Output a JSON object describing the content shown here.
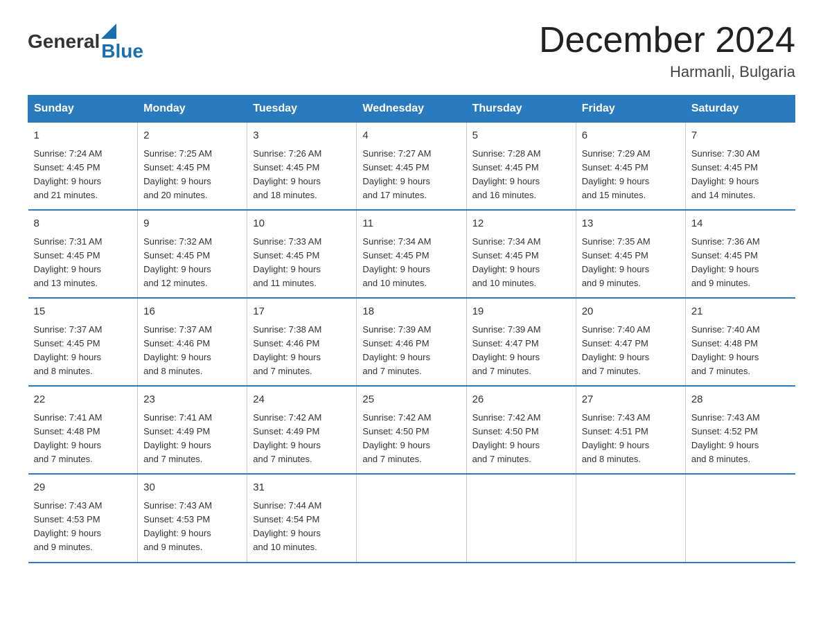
{
  "header": {
    "logo_general": "General",
    "logo_blue": "Blue",
    "title": "December 2024",
    "location": "Harmanli, Bulgaria"
  },
  "days_of_week": [
    "Sunday",
    "Monday",
    "Tuesday",
    "Wednesday",
    "Thursday",
    "Friday",
    "Saturday"
  ],
  "weeks": [
    [
      {
        "day": "1",
        "sunrise": "7:24 AM",
        "sunset": "4:45 PM",
        "daylight": "9 hours and 21 minutes."
      },
      {
        "day": "2",
        "sunrise": "7:25 AM",
        "sunset": "4:45 PM",
        "daylight": "9 hours and 20 minutes."
      },
      {
        "day": "3",
        "sunrise": "7:26 AM",
        "sunset": "4:45 PM",
        "daylight": "9 hours and 18 minutes."
      },
      {
        "day": "4",
        "sunrise": "7:27 AM",
        "sunset": "4:45 PM",
        "daylight": "9 hours and 17 minutes."
      },
      {
        "day": "5",
        "sunrise": "7:28 AM",
        "sunset": "4:45 PM",
        "daylight": "9 hours and 16 minutes."
      },
      {
        "day": "6",
        "sunrise": "7:29 AM",
        "sunset": "4:45 PM",
        "daylight": "9 hours and 15 minutes."
      },
      {
        "day": "7",
        "sunrise": "7:30 AM",
        "sunset": "4:45 PM",
        "daylight": "9 hours and 14 minutes."
      }
    ],
    [
      {
        "day": "8",
        "sunrise": "7:31 AM",
        "sunset": "4:45 PM",
        "daylight": "9 hours and 13 minutes."
      },
      {
        "day": "9",
        "sunrise": "7:32 AM",
        "sunset": "4:45 PM",
        "daylight": "9 hours and 12 minutes."
      },
      {
        "day": "10",
        "sunrise": "7:33 AM",
        "sunset": "4:45 PM",
        "daylight": "9 hours and 11 minutes."
      },
      {
        "day": "11",
        "sunrise": "7:34 AM",
        "sunset": "4:45 PM",
        "daylight": "9 hours and 10 minutes."
      },
      {
        "day": "12",
        "sunrise": "7:34 AM",
        "sunset": "4:45 PM",
        "daylight": "9 hours and 10 minutes."
      },
      {
        "day": "13",
        "sunrise": "7:35 AM",
        "sunset": "4:45 PM",
        "daylight": "9 hours and 9 minutes."
      },
      {
        "day": "14",
        "sunrise": "7:36 AM",
        "sunset": "4:45 PM",
        "daylight": "9 hours and 9 minutes."
      }
    ],
    [
      {
        "day": "15",
        "sunrise": "7:37 AM",
        "sunset": "4:45 PM",
        "daylight": "9 hours and 8 minutes."
      },
      {
        "day": "16",
        "sunrise": "7:37 AM",
        "sunset": "4:46 PM",
        "daylight": "9 hours and 8 minutes."
      },
      {
        "day": "17",
        "sunrise": "7:38 AM",
        "sunset": "4:46 PM",
        "daylight": "9 hours and 7 minutes."
      },
      {
        "day": "18",
        "sunrise": "7:39 AM",
        "sunset": "4:46 PM",
        "daylight": "9 hours and 7 minutes."
      },
      {
        "day": "19",
        "sunrise": "7:39 AM",
        "sunset": "4:47 PM",
        "daylight": "9 hours and 7 minutes."
      },
      {
        "day": "20",
        "sunrise": "7:40 AM",
        "sunset": "4:47 PM",
        "daylight": "9 hours and 7 minutes."
      },
      {
        "day": "21",
        "sunrise": "7:40 AM",
        "sunset": "4:48 PM",
        "daylight": "9 hours and 7 minutes."
      }
    ],
    [
      {
        "day": "22",
        "sunrise": "7:41 AM",
        "sunset": "4:48 PM",
        "daylight": "9 hours and 7 minutes."
      },
      {
        "day": "23",
        "sunrise": "7:41 AM",
        "sunset": "4:49 PM",
        "daylight": "9 hours and 7 minutes."
      },
      {
        "day": "24",
        "sunrise": "7:42 AM",
        "sunset": "4:49 PM",
        "daylight": "9 hours and 7 minutes."
      },
      {
        "day": "25",
        "sunrise": "7:42 AM",
        "sunset": "4:50 PM",
        "daylight": "9 hours and 7 minutes."
      },
      {
        "day": "26",
        "sunrise": "7:42 AM",
        "sunset": "4:50 PM",
        "daylight": "9 hours and 7 minutes."
      },
      {
        "day": "27",
        "sunrise": "7:43 AM",
        "sunset": "4:51 PM",
        "daylight": "9 hours and 8 minutes."
      },
      {
        "day": "28",
        "sunrise": "7:43 AM",
        "sunset": "4:52 PM",
        "daylight": "9 hours and 8 minutes."
      }
    ],
    [
      {
        "day": "29",
        "sunrise": "7:43 AM",
        "sunset": "4:53 PM",
        "daylight": "9 hours and 9 minutes."
      },
      {
        "day": "30",
        "sunrise": "7:43 AM",
        "sunset": "4:53 PM",
        "daylight": "9 hours and 9 minutes."
      },
      {
        "day": "31",
        "sunrise": "7:44 AM",
        "sunset": "4:54 PM",
        "daylight": "9 hours and 10 minutes."
      },
      {
        "day": "",
        "sunrise": "",
        "sunset": "",
        "daylight": ""
      },
      {
        "day": "",
        "sunrise": "",
        "sunset": "",
        "daylight": ""
      },
      {
        "day": "",
        "sunrise": "",
        "sunset": "",
        "daylight": ""
      },
      {
        "day": "",
        "sunrise": "",
        "sunset": "",
        "daylight": ""
      }
    ]
  ],
  "labels": {
    "sunrise": "Sunrise:",
    "sunset": "Sunset:",
    "daylight": "Daylight:"
  }
}
